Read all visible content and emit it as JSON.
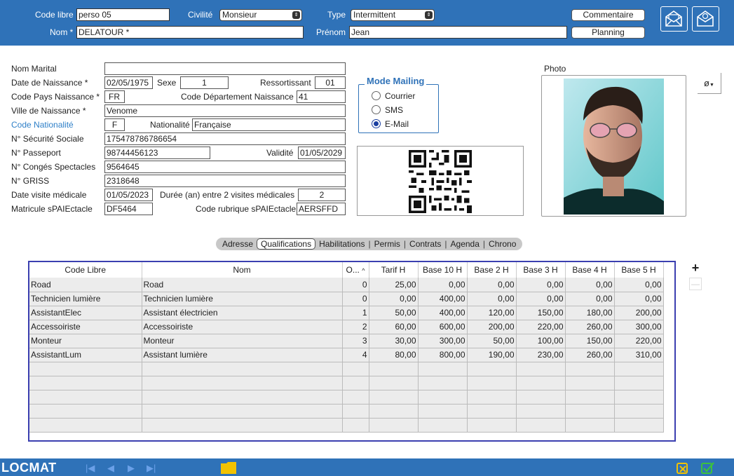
{
  "header": {
    "code_libre_label": "Code libre",
    "code_libre_value": "perso 05",
    "civilite_label": "Civilité",
    "civilite_value": "Monsieur",
    "type_label": "Type",
    "type_value": "Intermittent",
    "commentaire_label": "Commentaire",
    "nom_label": "Nom *",
    "nom_value": "DELATOUR *",
    "prenom_label": "Prénom",
    "prenom_value": "Jean",
    "planning_label": "Planning"
  },
  "form": {
    "nom_marital_label": "Nom Marital",
    "nom_marital_value": "",
    "date_naissance_label": "Date de Naissance *",
    "date_naissance_value": "02/05/1975",
    "sexe_label": "Sexe",
    "sexe_value": "1",
    "ressortissant_label": "Ressortissant",
    "ressortissant_value": "01",
    "code_pays_label": "Code Pays Naissance *",
    "code_pays_value": "FR",
    "code_dept_label": "Code Département Naissance",
    "code_dept_value": "41",
    "ville_label": "Ville de Naissance *",
    "ville_value": "Venome",
    "code_nat_label": "Code Nationalité",
    "code_nat_value": "F",
    "nationalite_label": "Nationalité",
    "nationalite_value": "Française",
    "secu_label": "N° Sécurité Sociale",
    "secu_value": "175478786786654",
    "passeport_label": "N° Passeport",
    "passeport_value": "98744456123",
    "validite_label": "Validité",
    "validite_value": "01/05/2029",
    "conges_label": "N° Congés Spectacles",
    "conges_value": "9564645",
    "griss_label": "N° GRISS",
    "griss_value": "2318648",
    "visite_label": "Date visite médicale",
    "visite_value": "01/05/2023",
    "duree_label": "Durée (an) entre 2 visites médicales",
    "duree_value": "2",
    "matricule_label": "Matricule sPAIEctacle",
    "matricule_value": "DF5464",
    "rubrique_label": "Code rubrique sPAIEctacle",
    "rubrique_value": "AERSFFD"
  },
  "mailing": {
    "title": "Mode Mailing",
    "options": [
      "Courrier",
      "SMS",
      "E-Mail"
    ],
    "selected": "E-Mail"
  },
  "photo": {
    "label": "Photo",
    "menu_label": "ø"
  },
  "tabs": [
    "Adresse",
    "Qualifications",
    "Habilitations",
    "Permis",
    "Contrats",
    "Agenda",
    "Chrono"
  ],
  "active_tab": "Qualifications",
  "table": {
    "columns": [
      "Code Libre",
      "Nom",
      "O...",
      "Tarif H",
      "Base 10 H",
      "Base 2 H",
      "Base 3 H",
      "Base 4 H",
      "Base 5 H"
    ],
    "rows": [
      [
        "Road",
        "Road",
        "0",
        "25,00",
        "0,00",
        "0,00",
        "0,00",
        "0,00",
        "0,00"
      ],
      [
        "Technicien lumière",
        "Technicien lumière",
        "0",
        "0,00",
        "400,00",
        "0,00",
        "0,00",
        "0,00",
        "0,00"
      ],
      [
        "AssistantElec",
        "Assistant électricien",
        "1",
        "50,00",
        "400,00",
        "120,00",
        "150,00",
        "180,00",
        "200,00"
      ],
      [
        "Accessoiriste",
        "Accessoiriste",
        "2",
        "60,00",
        "600,00",
        "200,00",
        "220,00",
        "260,00",
        "300,00"
      ],
      [
        "Monteur",
        "Monteur",
        "3",
        "30,00",
        "300,00",
        "50,00",
        "100,00",
        "150,00",
        "220,00"
      ],
      [
        "AssistantLum",
        "Assistant lumière",
        "4",
        "80,00",
        "800,00",
        "190,00",
        "230,00",
        "260,00",
        "310,00"
      ]
    ],
    "add_label": "+",
    "remove_label": "—"
  },
  "footer": {
    "logo": "LOCMAT"
  }
}
